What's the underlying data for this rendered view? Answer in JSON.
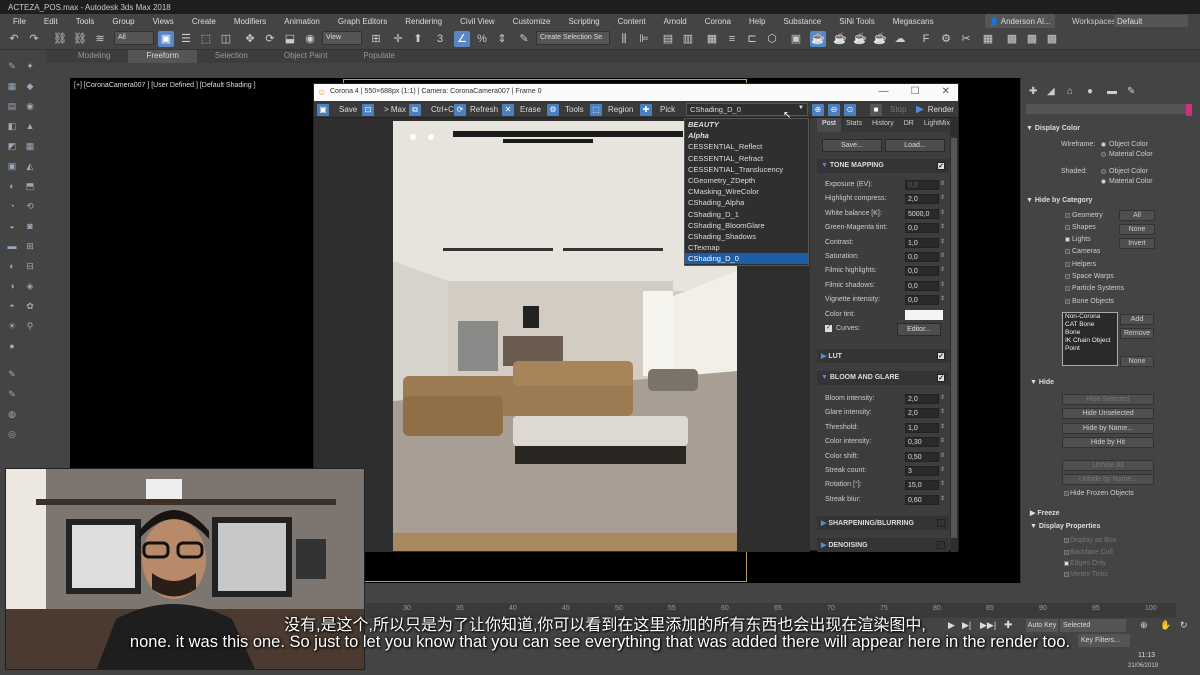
{
  "window": {
    "title": "ACTEZA_POS.max - Autodesk 3ds Max 2018"
  },
  "menu": [
    "File",
    "Edit",
    "Tools",
    "Group",
    "Views",
    "Create",
    "Modifiers",
    "Animation",
    "Graph Editors",
    "Rendering",
    "Civil View",
    "Customize",
    "Scripting",
    "Content",
    "Arnold",
    "Corona",
    "Help",
    "Substance",
    "SiNi Tools",
    "Megascans"
  ],
  "account": {
    "user": "Anderson Al...",
    "workspaces_label": "Workspaces:",
    "workspace": "Default"
  },
  "toolbar": {
    "filter": "All",
    "view": "View",
    "selection_set": "Create Selection Se"
  },
  "ribbon_tabs": [
    "Modeling",
    "Freeform",
    "Selection",
    "Object Paint",
    "Populate"
  ],
  "viewport": {
    "label": "[+] [CoronaCamera007 ] [User Defined ] [Default Shading ]"
  },
  "corona": {
    "title": "Corona 4 | 550×688px (1:1) | Camera: CoronaCamera007 | Frame 0",
    "toolbar": {
      "save": "Save",
      "to_max": "> Max",
      "copy": "Ctrl+C",
      "refresh": "Refresh",
      "erase": "Erase",
      "tools": "Tools",
      "region": "Region",
      "pick": "Pick",
      "channel": "CShading_D_0",
      "stop": "Stop",
      "render": "Render"
    },
    "channels": [
      "BEAUTY",
      "Alpha",
      "CESSENTIAL_Reflect",
      "CESSENTIAL_Refract",
      "CESSENTIAL_Translucency",
      "CGeometry_ZDepth",
      "CMasking_WireColor",
      "CShading_Alpha",
      "CShading_D_1",
      "CShading_BloomGlare",
      "CShading_Shadows",
      "CTexmap",
      "CShading_D_0"
    ],
    "panel_tabs": [
      "Post",
      "Stats",
      "History",
      "DR",
      "LightMix"
    ],
    "save_btn": "Save...",
    "load_btn": "Load...",
    "tone_mapping": {
      "title": "TONE MAPPING",
      "rows": [
        {
          "label": "Exposure (EV):",
          "value": "0,0"
        },
        {
          "label": "Highlight compress:",
          "value": "2,0"
        },
        {
          "label": "White balance [K]:",
          "value": "5000,0"
        },
        {
          "label": "Green-Magenta tint:",
          "value": "0,0"
        },
        {
          "label": "Contrast:",
          "value": "1,0"
        },
        {
          "label": "Saturation:",
          "value": "0,0"
        },
        {
          "label": "Filmic highlights:",
          "value": "0,0"
        },
        {
          "label": "Filmic shadows:",
          "value": "0,0"
        },
        {
          "label": "Vignette intensity:",
          "value": "0,0"
        }
      ],
      "color_tint": "Color tint:",
      "curves": "Curves:",
      "editor": "Editor..."
    },
    "lut": "LUT",
    "bloom": {
      "title": "BLOOM AND GLARE",
      "rows": [
        {
          "label": "Bloom intensity:",
          "value": "2,0"
        },
        {
          "label": "Glare intensity:",
          "value": "2,0"
        },
        {
          "label": "Threshold:",
          "value": "1,0"
        },
        {
          "label": "Color intensity:",
          "value": "0,30"
        },
        {
          "label": "Color shift:",
          "value": "0,50"
        },
        {
          "label": "Streak count:",
          "value": "3"
        },
        {
          "label": "Rotation [°]:",
          "value": "15,0"
        },
        {
          "label": "Streak blur:",
          "value": "0,60"
        }
      ]
    },
    "sharpening": "SHARPENING/BLURRING",
    "denoising": "DENOISING"
  },
  "command_panel": {
    "display_color": "Display Color",
    "wireframe": "Wireframe:",
    "shaded": "Shaded:",
    "object_color": "Object Color",
    "material_color": "Material Color",
    "hide_by_category": "Hide by Category",
    "categories": [
      "Geometry",
      "Shapes",
      "Lights",
      "Cameras",
      "Helpers",
      "Space Warps",
      "Particle Systems",
      "Bone Objects"
    ],
    "all": "All",
    "none": "None",
    "invert": "Invert",
    "list": [
      "Non-Corona",
      "CAT Bone",
      "Bone",
      "IK Chain Object",
      "Point"
    ],
    "add": "Add",
    "remove": "Remove",
    "none2": "None",
    "hide": "Hide",
    "hide_buttons": [
      "Hide Selected",
      "Hide Unselected",
      "Hide by Name...",
      "Hide by Hit",
      "Unhide All",
      "Unhide by Name..."
    ],
    "hide_frozen": "Hide Frozen Objects",
    "freeze": "Freeze",
    "display_props": "Display Properties",
    "props": [
      "Display as Box",
      "Backface Cull",
      "Edges Only",
      "Vertex Ticks"
    ]
  },
  "timeline": {
    "ticks": [
      "30",
      "35",
      "40",
      "45",
      "50",
      "55",
      "60",
      "65",
      "70",
      "75",
      "80",
      "85",
      "90",
      "95",
      "100"
    ],
    "autokey": "Auto Key",
    "selected": "Selected",
    "key_filters": "Key Filters..."
  },
  "subtitles": {
    "cn": "没有,是这个,所以只是为了让你知道,你可以看到在这里添加的所有东西也会出现在渲染图中,",
    "en": "none. it was this one. So just to let you know that you can see everything that was added there will appear here in the render too."
  },
  "clock": {
    "time": "11:13",
    "date": "21/06/2019"
  }
}
